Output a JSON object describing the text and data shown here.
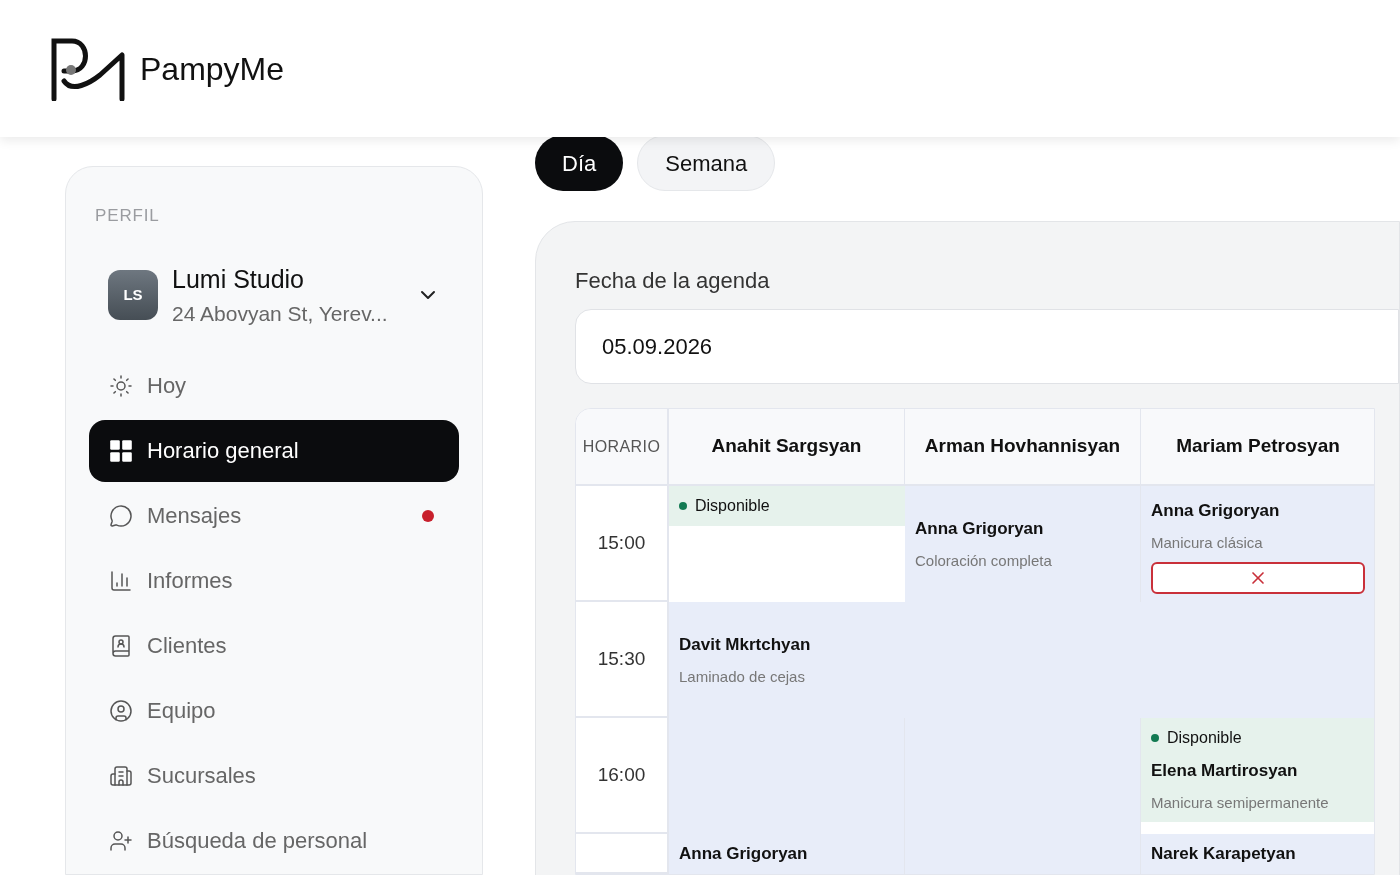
{
  "brand": {
    "name": "PampyMe"
  },
  "view_tabs": [
    {
      "label": "Día",
      "selected": true
    },
    {
      "label": "Semana",
      "selected": false
    }
  ],
  "sidebar": {
    "section_label": "PERFIL",
    "profile": {
      "initials": "LS",
      "name": "Lumi Studio",
      "address": "24 Abovyan St, Yerev..."
    },
    "items": [
      {
        "label": "Hoy",
        "selected": false,
        "unread": false
      },
      {
        "label": "Horario general",
        "selected": true,
        "unread": false
      },
      {
        "label": "Mensajes",
        "selected": false,
        "unread": true
      },
      {
        "label": "Informes",
        "selected": false,
        "unread": false
      },
      {
        "label": "Clientes",
        "selected": false,
        "unread": false
      },
      {
        "label": "Equipo",
        "selected": false,
        "unread": false
      },
      {
        "label": "Sucursales",
        "selected": false,
        "unread": false
      },
      {
        "label": "Búsqueda de personal",
        "selected": false,
        "unread": false
      }
    ]
  },
  "agenda": {
    "date_label": "Fecha de la agenda",
    "date_value": "05.09.2026",
    "time_header": "HORARIO",
    "staff": [
      "Anahit Sargsyan",
      "Arman Hovhannisyan",
      "Mariam Petrosyan"
    ],
    "rows": [
      {
        "time": "15:00",
        "cells": [
          {
            "kind": "available",
            "wide": false,
            "status": "Disponible"
          },
          {
            "kind": "appointment",
            "wide": false,
            "client": "Anna Grigoryan",
            "service": "Coloración completa",
            "cancel": false
          },
          {
            "kind": "appointment",
            "wide": false,
            "client": "Anna Grigoryan",
            "service": "Manicura clásica",
            "cancel": true
          }
        ]
      },
      {
        "time": "15:30",
        "cells": [
          {
            "kind": "appointment",
            "wide": true,
            "client": "Davit Mkrtchyan",
            "service": "Laminado de cejas",
            "cancel": false
          }
        ]
      },
      {
        "time": "16:00",
        "cells": [
          {
            "kind": "empty",
            "wide": false
          },
          {
            "kind": "empty",
            "wide": false
          },
          {
            "kind": "available",
            "wide": false,
            "status": "Disponible",
            "client": "Elena Martirosyan",
            "service": "Manicura semipermanente"
          }
        ]
      },
      {
        "cells": [
          {
            "kind": "appointment",
            "wide": false,
            "client": "Anna Grigoryan",
            "cancel": false
          },
          {
            "kind": "empty",
            "wide": false
          },
          {
            "kind": "appointment",
            "wide": false,
            "client": "Narek Karapetyan",
            "cancel": false
          }
        ]
      }
    ]
  }
}
